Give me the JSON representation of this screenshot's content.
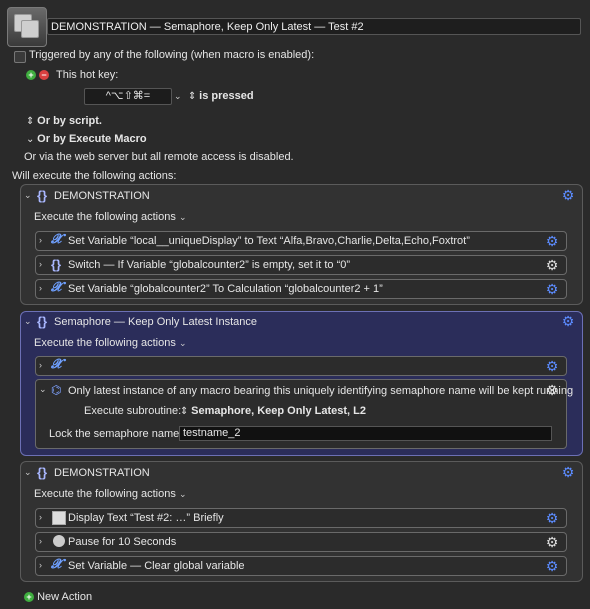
{
  "header": {
    "title": "DEMONSTRATION — Semaphore, Keep Only Latest — Test #2",
    "triggered_label": "Triggered by any of the following (when macro is enabled):",
    "hotkey_label": "This hot key:",
    "hotkey_value": "^⌥⇧⌘=",
    "hotkey_state": "is pressed",
    "or_by_script": "Or by script.",
    "or_by_execute": "Or by Execute Macro",
    "web_server": "Or via the web server but all remote access is disabled.",
    "will_execute": "Will execute the following actions:"
  },
  "groups": [
    {
      "title": "DEMONSTRATION",
      "subtitle": "Execute the following actions",
      "actions": [
        {
          "label": "Set Variable “local__uniqueDisplay” to Text “Alfa,Bravo,Charlie,Delta,Echo,Foxtrot”"
        },
        {
          "label": "Switch — If Variable “globalcounter2” is empty, set it to “0”"
        },
        {
          "label": "Set Variable “globalcounter2” To Calculation “globalcounter2 + 1”"
        }
      ]
    },
    {
      "title": "Semaphore — Keep Only Latest Instance",
      "subtitle": "Execute the following actions",
      "semaphore_text": "Only latest instance of any macro bearing this uniquely identifying semaphore name will be kept running",
      "subroutine_label": "Execute subroutine:",
      "subroutine_value": "Semaphore, Keep Only Latest, L2",
      "lock_label": "Lock the semaphore named",
      "lock_value": "testname_2"
    },
    {
      "title": "DEMONSTRATION",
      "subtitle": "Execute the following actions",
      "actions": [
        {
          "label": "Display Text “Test #2: …” Briefly"
        },
        {
          "label": "Pause for 10 Seconds"
        },
        {
          "label": "Set Variable — Clear global variable"
        }
      ]
    }
  ],
  "footer": {
    "new_action": "New Action"
  },
  "icons": {
    "chevron": "chevron-icon",
    "gear": "gear-icon",
    "variable": "variable-icon",
    "group": "group-icon"
  },
  "colors": {
    "background": "#2a2a2a",
    "selected_panel": "#2b2d5a",
    "gear_blue": "#5c8cff",
    "add_green": "#3fae3f",
    "remove_red": "#d94040"
  }
}
